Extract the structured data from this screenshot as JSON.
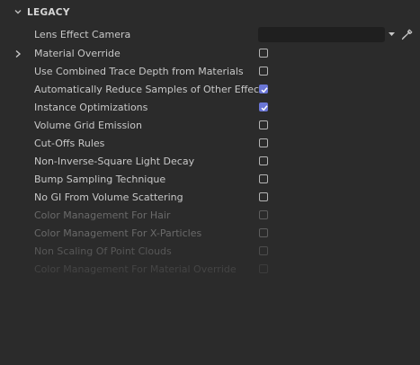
{
  "section": {
    "title": "LEGACY",
    "icon": "chevron-down-icon"
  },
  "lens_effect_camera": {
    "label": "Lens Effect Camera",
    "value": "",
    "dropdown_icon": "caret-down-icon",
    "picker_icon": "eyedropper-icon"
  },
  "options": [
    {
      "id": "material-override",
      "label": "Material Override",
      "checked": false,
      "expandable": true,
      "state": "normal"
    },
    {
      "id": "use-combined-trace-depth",
      "label": "Use Combined Trace Depth from Materials",
      "checked": false,
      "state": "normal"
    },
    {
      "id": "auto-reduce-samples",
      "label": "Automatically Reduce Samples of Other Effects",
      "checked": true,
      "state": "normal"
    },
    {
      "id": "instance-optimizations",
      "label": "Instance Optimizations",
      "checked": true,
      "state": "normal"
    },
    {
      "id": "volume-grid-emission",
      "label": "Volume Grid Emission",
      "checked": false,
      "state": "normal"
    },
    {
      "id": "cut-offs-rules",
      "label": "Cut-Offs Rules",
      "checked": false,
      "state": "normal"
    },
    {
      "id": "non-inverse-square-light-decay",
      "label": "Non-Inverse-Square Light Decay",
      "checked": false,
      "state": "normal"
    },
    {
      "id": "bump-sampling-technique",
      "label": "Bump Sampling Technique",
      "checked": false,
      "state": "normal"
    },
    {
      "id": "no-gi-from-volume-scattering",
      "label": "No GI From Volume Scattering",
      "checked": false,
      "state": "normal"
    },
    {
      "id": "color-management-for-hair",
      "label": "Color Management For Hair",
      "checked": false,
      "state": "dim"
    },
    {
      "id": "color-management-for-x-particles",
      "label": "Color Management For X-Particles",
      "checked": false,
      "state": "dim"
    },
    {
      "id": "non-scaling-of-point-clouds",
      "label": "Non Scaling Of Point Clouds",
      "checked": false,
      "state": "dim2"
    },
    {
      "id": "color-management-for-material-override",
      "label": "Color Management For Material Override",
      "checked": false,
      "state": "dim3"
    }
  ],
  "colors": {
    "background": "#2b2b2b",
    "text": "#c8c8c8",
    "accent": "#6a76d6",
    "field": "#1f1f1f"
  }
}
